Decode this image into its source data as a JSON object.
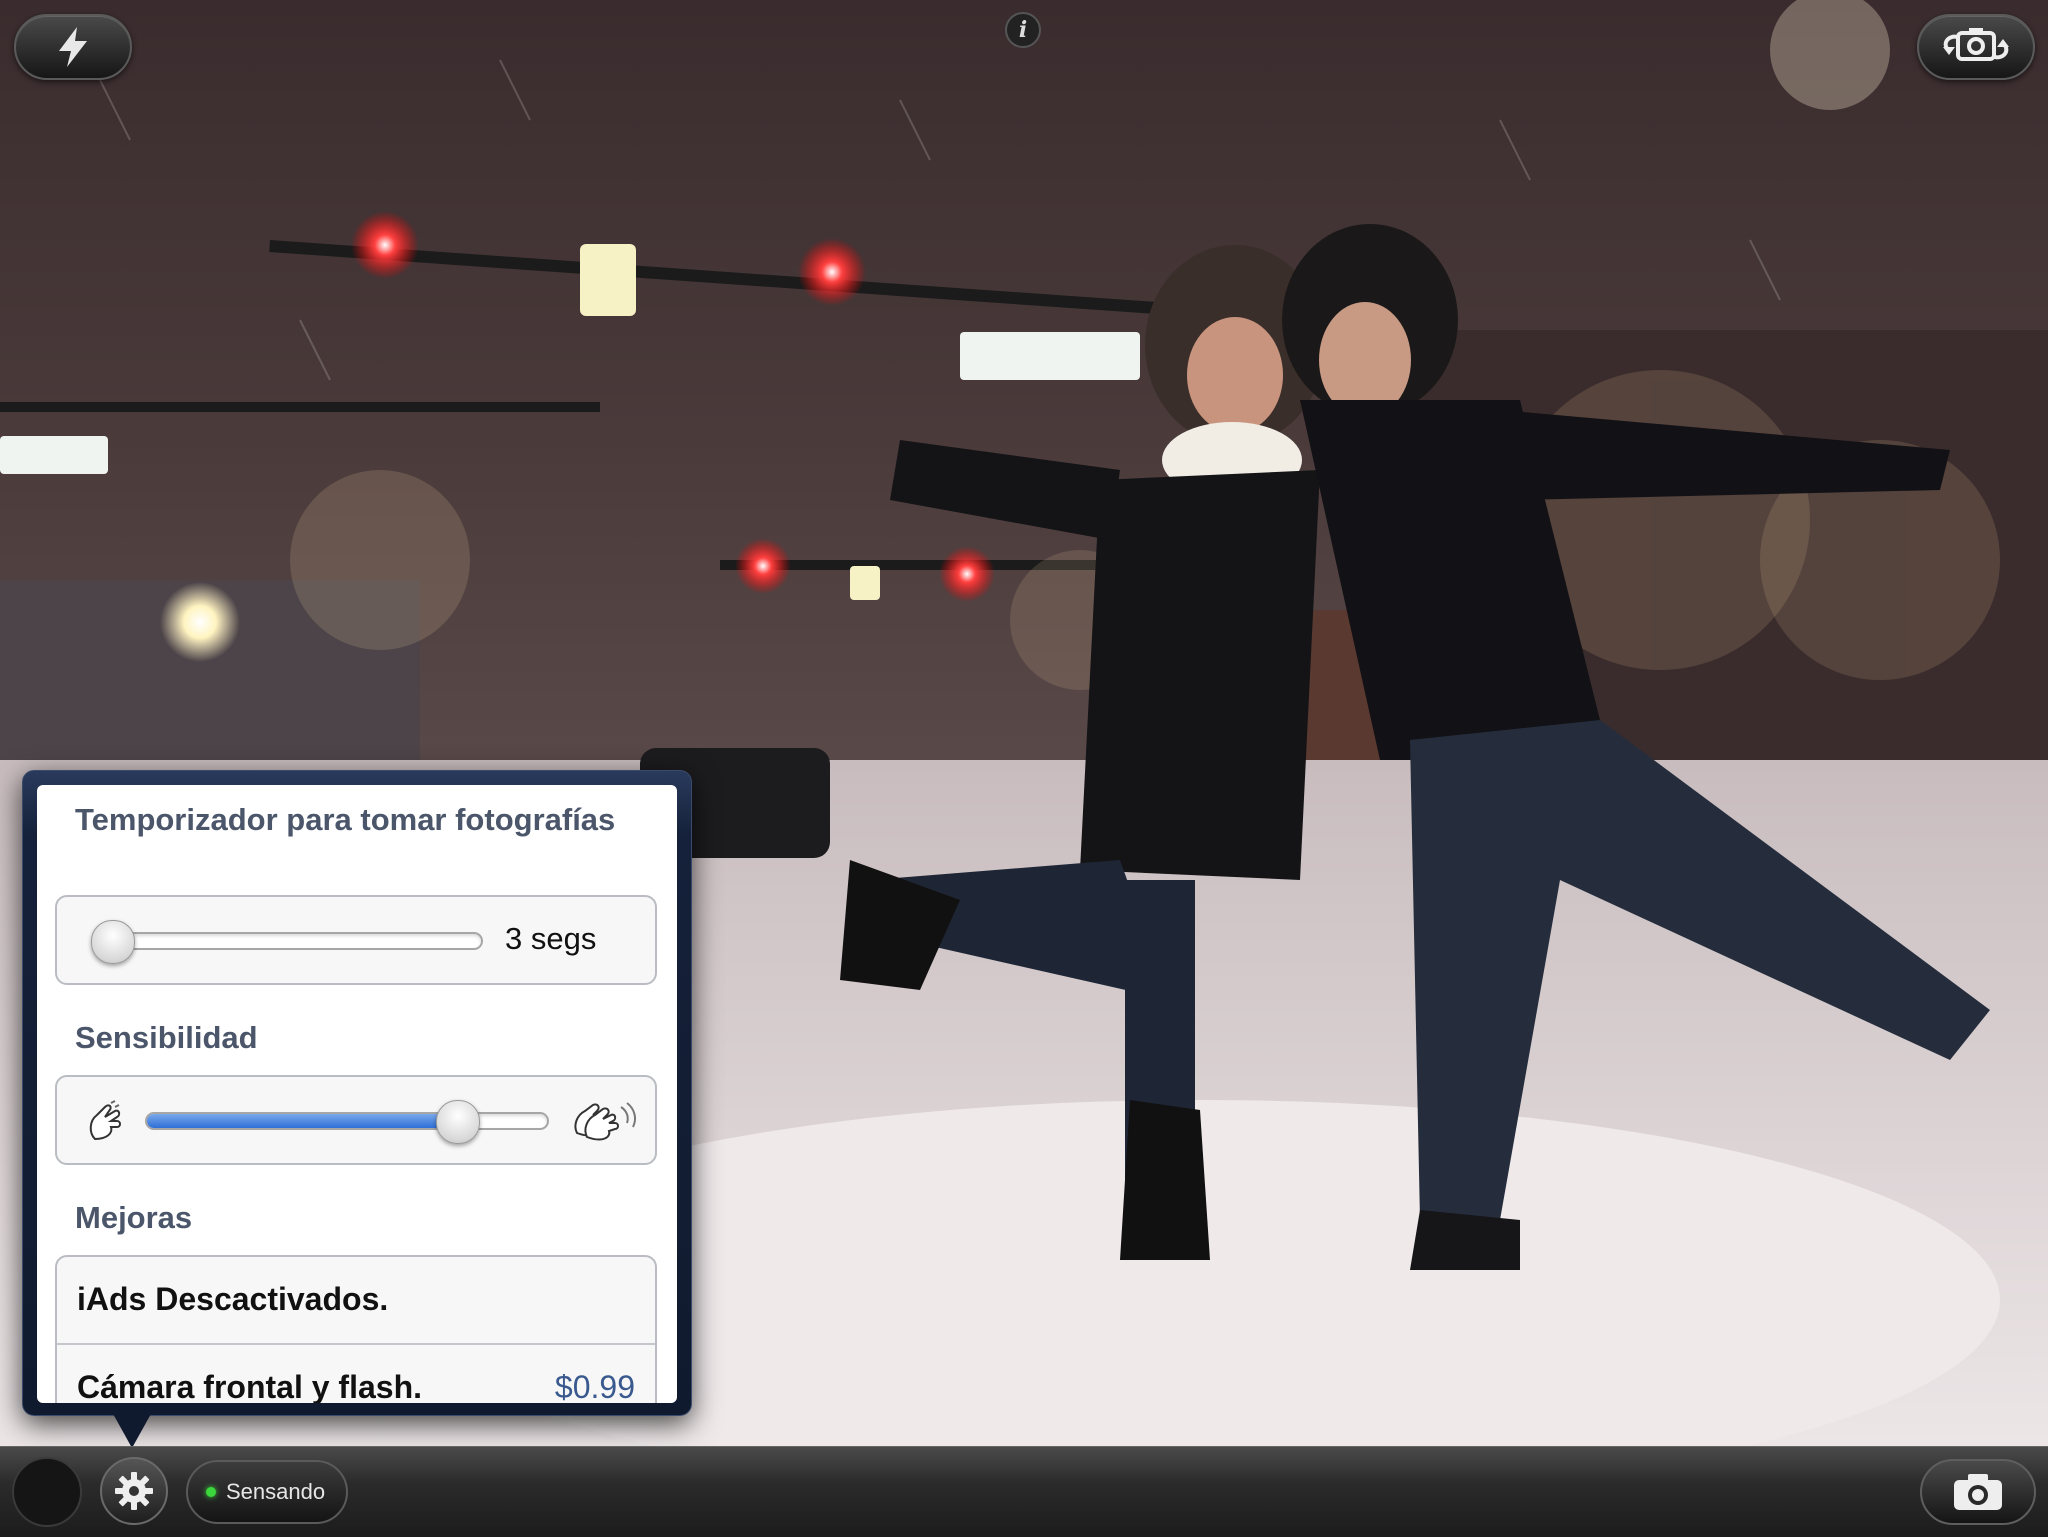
{
  "top_bar": {
    "flash_icon": "lightning-bolt-icon",
    "info_icon": "info-icon",
    "info_label": "i",
    "flip_camera_icon": "camera-flip-icon"
  },
  "settings_popover": {
    "timer": {
      "title": "Temporizador para tomar fotografías",
      "value_label": "3 segs",
      "slider_fraction": 0.0
    },
    "sensitivity": {
      "title": "Sensibilidad",
      "low_icon": "single-clap-icon",
      "high_icon": "loud-clap-icon",
      "slider_fraction": 0.77
    },
    "upgrades": {
      "title": "Mejoras",
      "items": [
        {
          "label": "iAds Descactivados.",
          "price": ""
        },
        {
          "label": "Cámara frontal y flash.",
          "price": "$0.99"
        }
      ]
    }
  },
  "toolbar": {
    "settings_icon": "gear-icon",
    "status_label": "Sensando",
    "status_color": "#3bd83b",
    "shutter_icon": "camera-icon"
  }
}
